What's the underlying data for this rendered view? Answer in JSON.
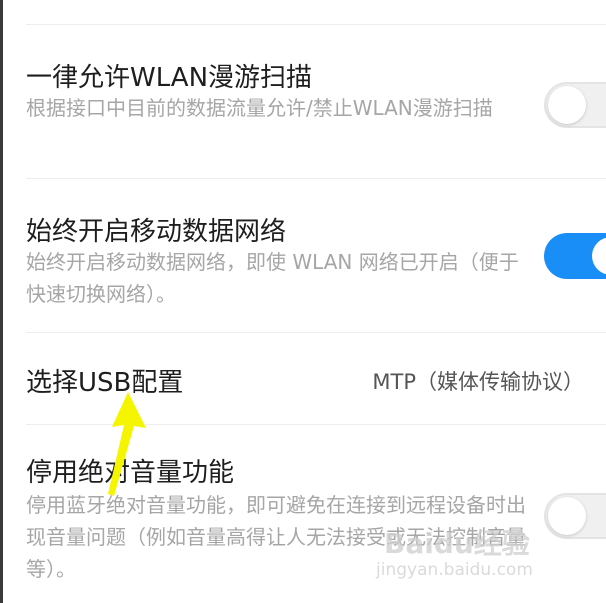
{
  "settings": [
    {
      "title": "一律允许WLAN漫游扫描",
      "subtitle": "根据接口中目前的数据流量允许/禁止WLAN漫游扫描",
      "toggle": "off"
    },
    {
      "title": "始终开启移动数据网络",
      "subtitle": "始终开启移动数据网络，即使 WLAN 网络已开启（便于快速切换网络）。",
      "toggle": "on"
    },
    {
      "title": "选择USB配置",
      "value": "MTP（媒体传输协议）"
    },
    {
      "title": "停用绝对音量功能",
      "subtitle": "停用蓝牙绝对音量功能，即可避免在连接到远程设备时出现音量问题（例如音量高得让人无法接受或无法控制音量等）。",
      "toggle": "off"
    }
  ],
  "annotation": {
    "arrow_color": "#f5f500"
  },
  "watermark": {
    "brand": "Baidu经验",
    "url": "jingyan.baidu.com"
  },
  "colors": {
    "accent": "#1a8ef7",
    "toggle_off": "#f0f0f0",
    "subtitle": "#a6a6a6"
  }
}
